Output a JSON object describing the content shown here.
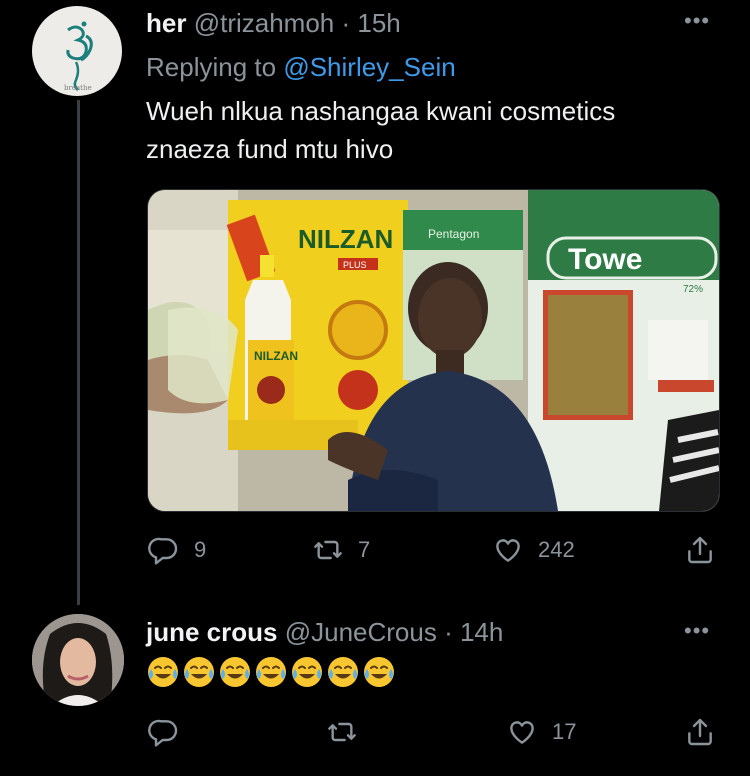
{
  "tweets": [
    {
      "display_name": "her",
      "handle": "@trizahmoh",
      "time": "· 15h",
      "replying_prefix": "Replying to",
      "replying_handle": "@Shirley_Sein",
      "text_line1": "Wueh nlkua nashangaa kwani cosmetics",
      "text_line2": "znaeza fund mtu hivo",
      "avatar_caption": "breathe",
      "media": {
        "nilzan_brand": "NILZAN",
        "nilzan_plus": "PLUS",
        "bottle_label": "NILZAN",
        "pentagon_brand": "Pentagon",
        "tower_brand": "Towe",
        "tower_pct": "72%"
      },
      "actions": {
        "replies": "9",
        "retweets": "7",
        "likes": "242"
      }
    },
    {
      "display_name": "june crous",
      "handle": "@JuneCrous",
      "time": "· 14h",
      "emoji_text": "😂😂😂😂😂😂😂",
      "actions": {
        "replies": "",
        "retweets": "",
        "likes": "17"
      }
    }
  ],
  "icons": [
    "reply-icon",
    "retweet-icon",
    "like-icon",
    "share-icon",
    "more-icon"
  ],
  "colors": {
    "background": "#000000",
    "link": "#3d9be9",
    "muted": "#8b949b",
    "text": "#e7e9ea"
  }
}
